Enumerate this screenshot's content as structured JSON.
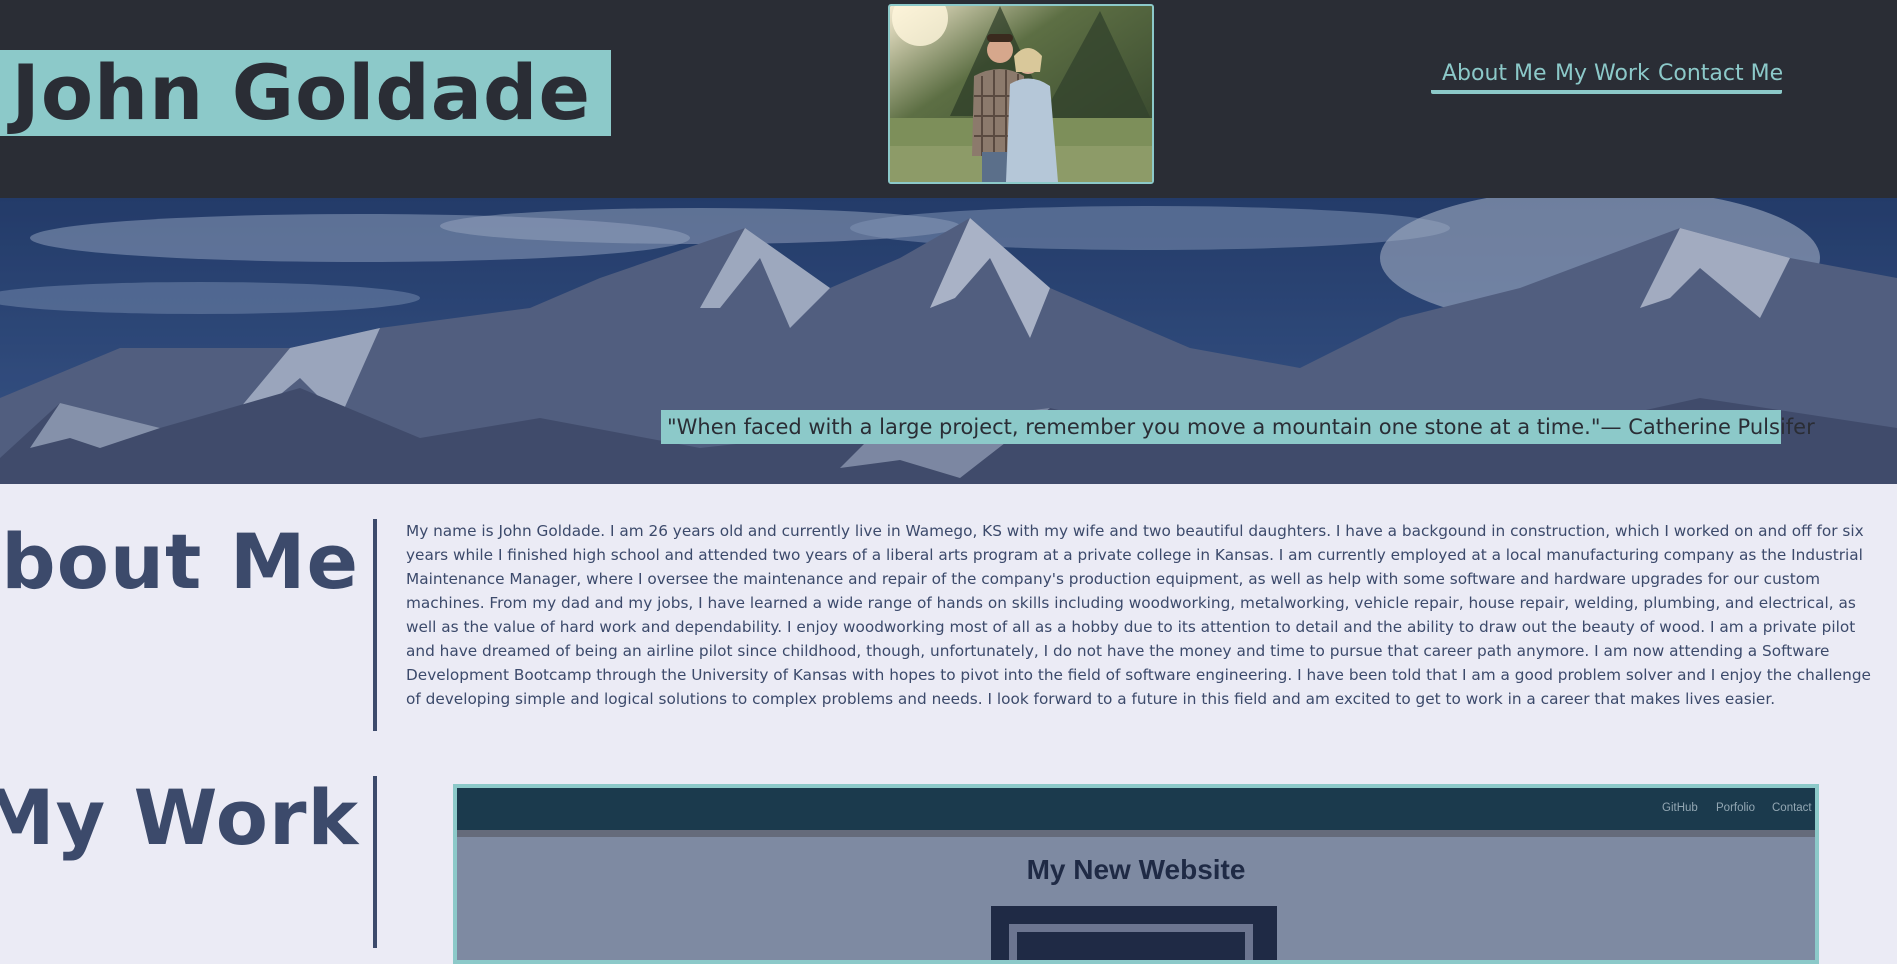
{
  "header": {
    "name": "John Goldade",
    "nav": [
      {
        "label": "About Me"
      },
      {
        "label": "My Work"
      },
      {
        "label": "Contact Me"
      }
    ]
  },
  "hero": {
    "quote": "\"When faced with a large project, remember you move a mountain one stone at a time.\"— Catherine Pulsifer"
  },
  "about": {
    "title": "About Me",
    "text": "My name is John Goldade. I am 26 years old and currently live in Wamego, KS with my wife and two beautiful daughters. I have a backgound in construction, which I worked on and off for six years while I finished high school and attended two years of a liberal arts program at a private college in Kansas. I am currently employed at a local manufacturing company as the Industrial Maintenance Manager, where I oversee the maintenance and repair of the company's production equipment, as well as help with some software and hardware upgrades for our custom machines. From my dad and my jobs, I have learned a wide range of hands on skills including woodworking, metalworking, vehicle repair, house repair, welding, plumbing, and electrical, as well as the value of hard work and dependability. I enjoy woodworking most of all as a hobby due to its attention to detail and the ability to draw out the beauty of wood. I am a private pilot and have dreamed of being an airline pilot since childhood, though, unfortunately, I do not have the money and time to pursue that career path anymore. I am now attending a Software Development Bootcamp through the University of Kansas with hopes to pivot into the field of software engineering. I have been told that I am a good problem solver and I enjoy the challenge of developing simple and logical solutions to complex problems and needs. I look forward to a future in this field and am excited to get to work in a career that makes lives easier."
  },
  "work": {
    "title": "My Work",
    "preview": {
      "nav": [
        "GitHub",
        "Porfolio",
        "Contact"
      ],
      "title": "My New Website"
    }
  },
  "colors": {
    "header_bg": "#2a2d35",
    "accent": "#8cc9c9",
    "page_bg": "#ebebf5",
    "section_text": "#3c4a6b"
  }
}
